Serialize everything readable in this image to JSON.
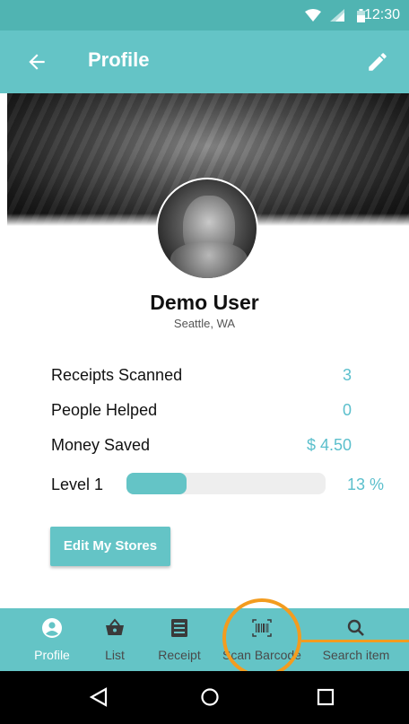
{
  "status_bar": {
    "time": "12:30"
  },
  "app_bar": {
    "title": "Profile"
  },
  "profile": {
    "name": "Demo User",
    "location": "Seattle, WA"
  },
  "stats": [
    {
      "label": "Receipts Scanned",
      "value": "3"
    },
    {
      "label": "People Helped",
      "value": "0"
    },
    {
      "label": "Money Saved",
      "value": "$ 4.50"
    }
  ],
  "level": {
    "label": "Level 1",
    "percent_text": "13 %",
    "progress": 0.3
  },
  "edit_stores_label": "Edit My Stores",
  "bottom_nav": [
    {
      "label": "Profile",
      "icon": "account-circle-icon",
      "active": true
    },
    {
      "label": "List",
      "icon": "basket-icon",
      "active": false
    },
    {
      "label": "Receipt",
      "icon": "receipt-icon",
      "active": false
    },
    {
      "label": "Scan Barcode",
      "icon": "barcode-icon",
      "active": false
    },
    {
      "label": "Search item",
      "icon": "search-icon",
      "active": false
    }
  ],
  "colors": {
    "primary": "#64c4c6",
    "status": "#50b4b2",
    "accent_text": "#5bbfcc",
    "highlight": "#f39c1f"
  }
}
